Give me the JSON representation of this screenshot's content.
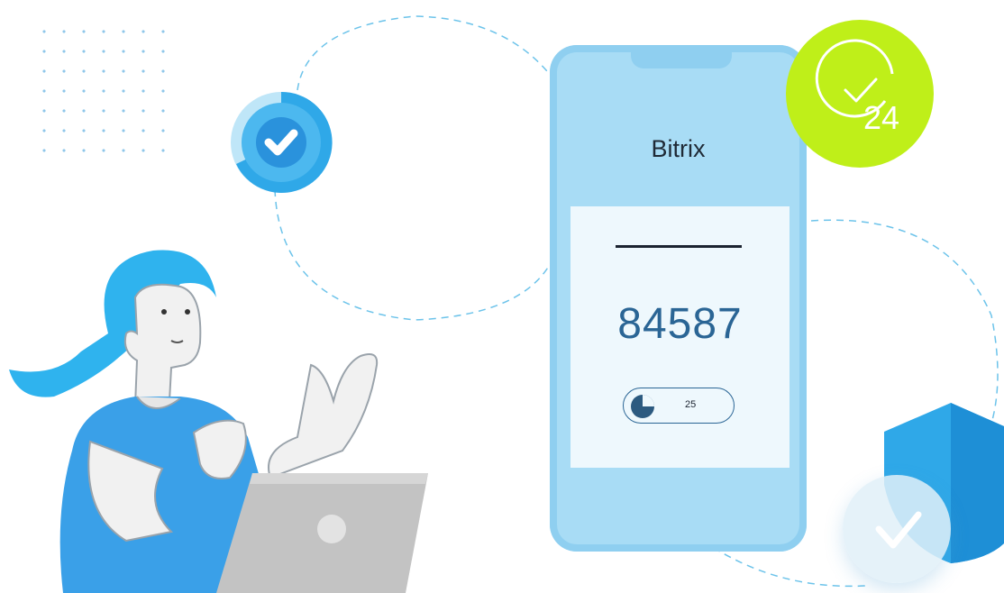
{
  "phone": {
    "brand": "Bitrix",
    "code": "84587",
    "timer_value": "25"
  },
  "badge": {
    "number": "24"
  },
  "colors": {
    "phone_body": "#a8dcf5",
    "card": "#eef8fd",
    "code_text": "#2a6595",
    "bitrix24_badge": "#bfef19",
    "accent_blue": "#2fa8e8"
  },
  "icons": [
    "check-circle-icon",
    "clock-24-icon",
    "shield-icon",
    "pie-timer-icon",
    "laptop-icon"
  ]
}
